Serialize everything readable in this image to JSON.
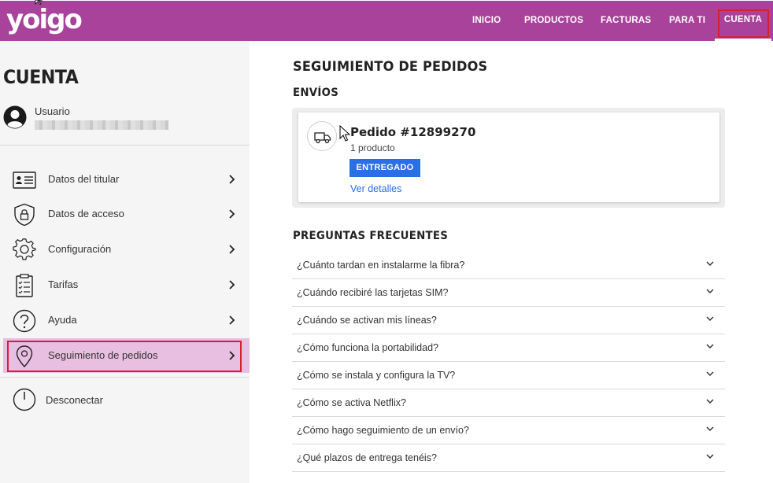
{
  "header": {
    "logo": "yoigo",
    "nav": [
      {
        "label": "INICIO"
      },
      {
        "label": "PRODUCTOS"
      },
      {
        "label": "FACTURAS"
      },
      {
        "label": "PARA TI"
      },
      {
        "label": "CUENTA"
      }
    ],
    "colors": {
      "brand": "#a9429a",
      "highlight": "#d81f2d"
    }
  },
  "sidebar": {
    "title": "CUENTA",
    "user_label": "Usuario",
    "menu": [
      {
        "label": "Datos del titular",
        "icon": "id-card-icon"
      },
      {
        "label": "Datos de acceso",
        "icon": "shield-lock-icon"
      },
      {
        "label": "Configuración",
        "icon": "gear-icon"
      },
      {
        "label": "Tarifas",
        "icon": "clipboard-check-icon"
      },
      {
        "label": "Ayuda",
        "icon": "question-icon"
      },
      {
        "label": "Seguimiento de pedidos",
        "icon": "location-pin-icon",
        "active": true
      }
    ],
    "logout_label": "Desconectar"
  },
  "main": {
    "page_title": "SEGUIMIENTO DE PEDIDOS",
    "envios_title": "ENVÍOS",
    "order": {
      "id": "Pedido #12899270",
      "count": "1 producto",
      "status": "ENTREGADO",
      "link": "Ver detalles",
      "status_color": "#2a6ee8"
    },
    "faq_title": "PREGUNTAS FRECUENTES",
    "faq": [
      "¿Cuánto tardan en instalarme la fibra?",
      "¿Cuándo recibiré las tarjetas SIM?",
      "¿Cuándo se activan mis líneas?",
      "¿Cómo funciona la portabilidad?",
      "¿Cómo se instala y configura la TV?",
      "¿Cómo se activa Netflix?",
      "¿Cómo hago seguimiento de un envío?",
      "¿Qué plazos de entrega tenéis?"
    ]
  }
}
